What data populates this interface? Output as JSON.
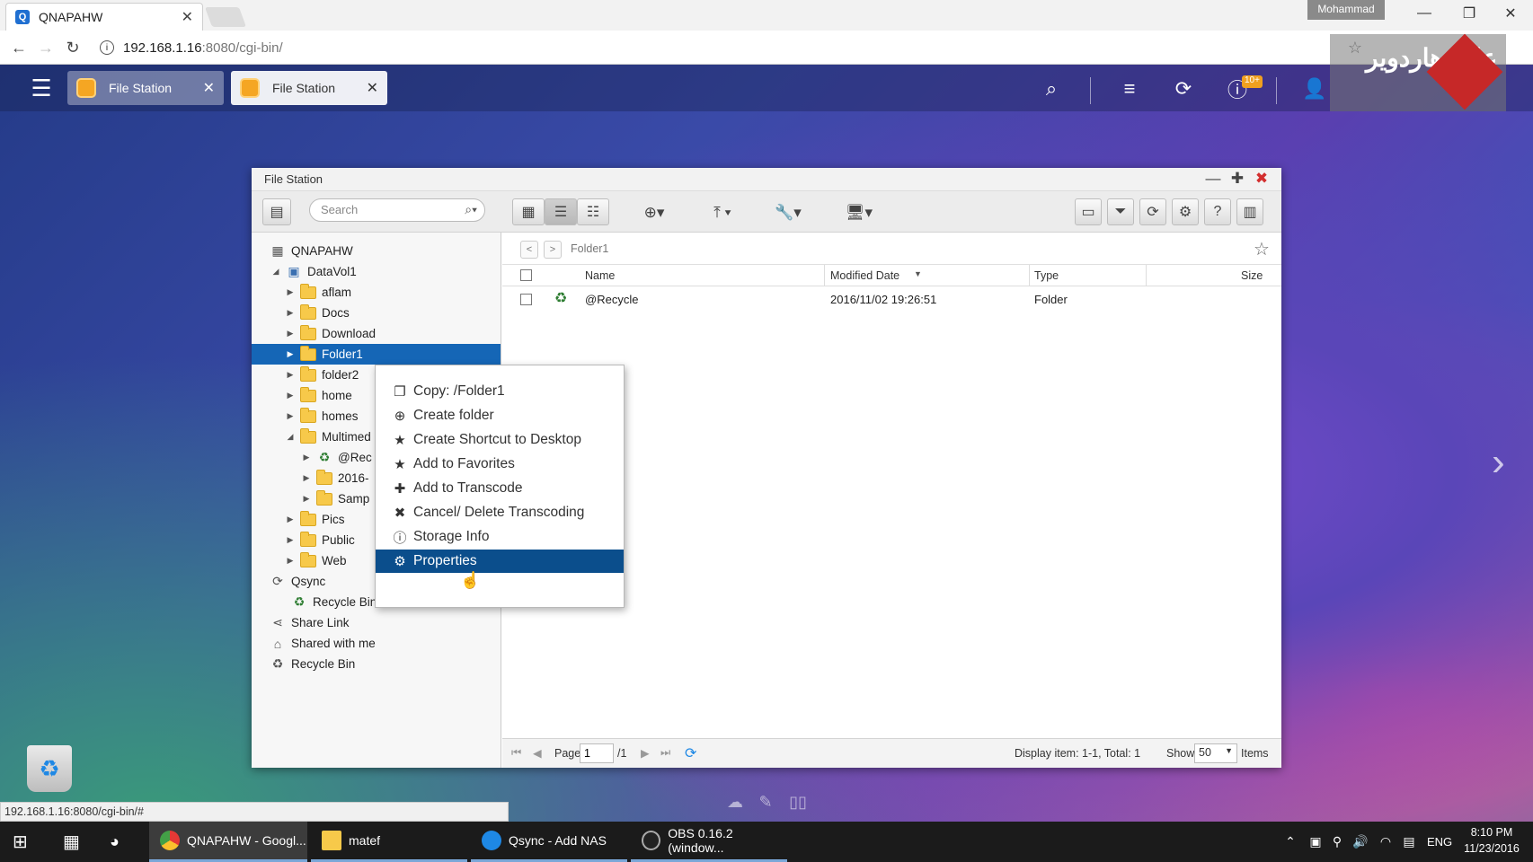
{
  "browser": {
    "tab_title": "QNAPAHW",
    "user": "Mohammad",
    "url_host": "192.168.1.16",
    "url_rest": ":8080/cgi-bin/",
    "status_url": "192.168.1.16:8080/cgi-bin/#"
  },
  "qts": {
    "tabs": [
      {
        "label": "File Station"
      },
      {
        "label": "File Station"
      }
    ],
    "notification_count": "10+",
    "logo_text": "عالم هاردوير"
  },
  "window": {
    "title": "File Station",
    "search_placeholder": "Search",
    "path": "Folder1"
  },
  "tree": {
    "root": "QNAPAHW",
    "volume": "DataVol1",
    "folders": [
      "aflam",
      "Docs",
      "Download",
      "Folder1",
      "folder2",
      "home",
      "homes",
      "Multimed"
    ],
    "multimedia_children": [
      "@Rec",
      "2016-",
      "Samp"
    ],
    "folders_after": [
      "Pics",
      "Public",
      "Web"
    ],
    "qsync": "Qsync",
    "qsync_recycle": "Recycle Bin",
    "share_link": "Share Link",
    "shared_with_me": "Shared with me",
    "recycle_bin": "Recycle Bin"
  },
  "table": {
    "columns": {
      "name": "Name",
      "modified": "Modified Date",
      "type": "Type",
      "size": "Size"
    },
    "rows": [
      {
        "name": "@Recycle",
        "modified": "2016/11/02 19:26:51",
        "type": "Folder",
        "size": ""
      }
    ]
  },
  "footer": {
    "page_label": "Page",
    "page_value": "1",
    "page_total": "/1",
    "display": "Display item: 1-1, Total: 1",
    "show_label": "Show",
    "show_value": "50",
    "items_label": "Items"
  },
  "context_menu": [
    {
      "label": "Copy: /Folder1",
      "icon": "copy-icon"
    },
    {
      "label": "Create folder",
      "icon": "plus-circle-icon"
    },
    {
      "label": "Create Shortcut to Desktop",
      "icon": "star-icon"
    },
    {
      "label": "Add to Favorites",
      "icon": "star-icon"
    },
    {
      "label": "Add to Transcode",
      "icon": "plus-icon"
    },
    {
      "label": "Cancel/ Delete Transcoding",
      "icon": "x-icon"
    },
    {
      "label": "Storage Info",
      "icon": "info-icon"
    },
    {
      "label": "Properties",
      "icon": "gears-icon"
    }
  ],
  "taskbar": {
    "apps": [
      {
        "label": "QNAPAHW - Googl..."
      },
      {
        "label": "matef"
      },
      {
        "label": "Qsync - Add NAS"
      },
      {
        "label": "OBS 0.16.2 (window..."
      }
    ],
    "lang": "ENG",
    "time": "8:10 PM",
    "date": "11/23/2016"
  },
  "colors": {
    "selection": "#1566b6",
    "menu_highlight": "#0b4e8c",
    "taskbar": "#1b1b1b"
  }
}
